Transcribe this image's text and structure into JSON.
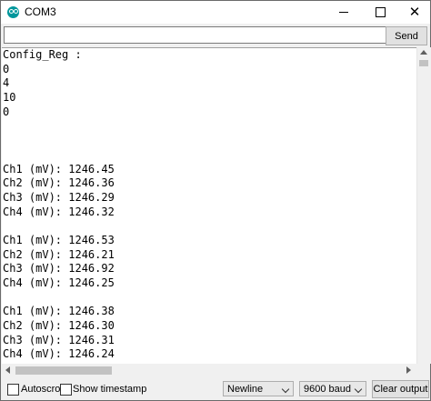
{
  "window": {
    "title": "COM3",
    "minimize_icon": "minimize-icon",
    "maximize_icon": "maximize-icon",
    "close_icon": "close-icon",
    "close_glyph": "✕"
  },
  "input": {
    "value": "",
    "send_label": "Send"
  },
  "output": {
    "lines": [
      "Config_Reg :",
      "0",
      "4",
      "10",
      "0",
      "",
      "",
      "",
      "Ch1 (mV): 1246.45",
      "Ch2 (mV): 1246.36",
      "Ch3 (mV): 1246.29",
      "Ch4 (mV): 1246.32",
      "",
      "Ch1 (mV): 1246.53",
      "Ch2 (mV): 1246.21",
      "Ch3 (mV): 1246.92",
      "Ch4 (mV): 1246.25",
      "",
      "Ch1 (mV): 1246.38",
      "Ch2 (mV): 1246.30",
      "Ch3 (mV): 1246.31",
      "Ch4 (mV): 1246.24"
    ]
  },
  "bottom": {
    "autoscroll_label": "Autoscroll",
    "autoscroll_checked": false,
    "timestamp_label": "Show timestamp",
    "timestamp_checked": false,
    "line_ending": "Newline",
    "baud_rate": "9600 baud",
    "clear_label": "Clear output"
  }
}
